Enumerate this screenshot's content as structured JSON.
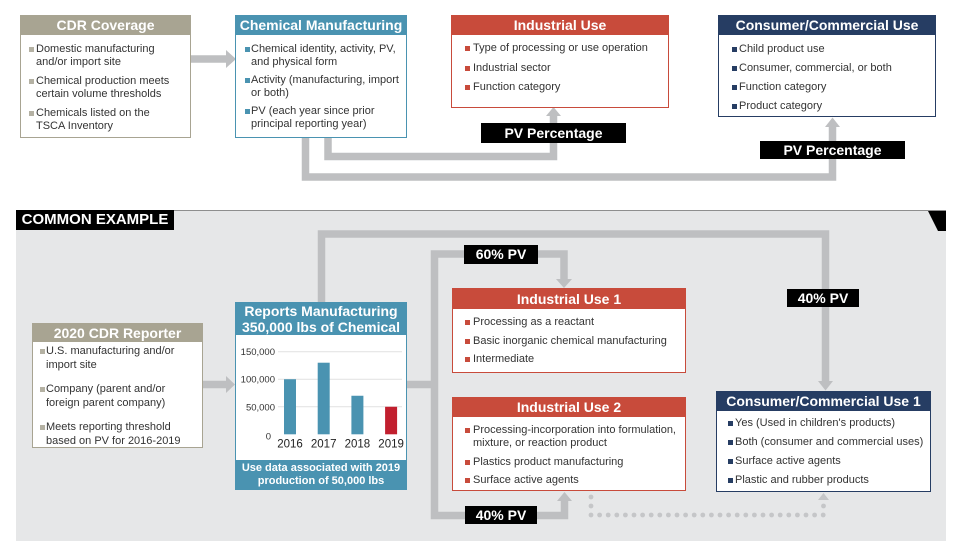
{
  "colors": {
    "cdr_olive": "#a8a492",
    "teal": "#4a93b1",
    "red": "#c84b3b",
    "navy": "#263d63",
    "connector": "#bebfc1",
    "panel": "#e6e7e8"
  },
  "top": {
    "cdr_coverage": {
      "title": "CDR Coverage",
      "items": [
        "Domestic manufacturing and/or import site",
        "Chemical production meets certain volume thresholds",
        "Chemicals listed on the TSCA Inventory"
      ]
    },
    "chemical_manufacturing": {
      "title": "Chemical Manufacturing",
      "items": [
        "Chemical identity, activity, PV, and physical form",
        "Activity (manufacturing, import or both)",
        "PV (each year since prior principal reporting year)"
      ]
    },
    "industrial_use": {
      "title": "Industrial Use",
      "items": [
        "Type of processing or use operation",
        "Industrial sector",
        "Function category"
      ]
    },
    "consumer_commercial_use": {
      "title": "Consumer/Commercial Use",
      "items": [
        "Child product use",
        "Consumer, commercial, or both",
        "Function category",
        "Product category"
      ]
    },
    "pv_label_industrial": "PV Percentage",
    "pv_label_consumer": "PV Percentage"
  },
  "example": {
    "section_label": "COMMON EXAMPLE",
    "cdr_reporter": {
      "title": "2020 CDR Reporter",
      "items": [
        "U.S. manufacturing and/or import site",
        "Company (parent and/or foreign parent company)",
        "Meets reporting threshold based on PV for 2016-2019"
      ]
    },
    "reports_manufacturing": {
      "title_lines": [
        "Reports Manufacturing",
        "350,000 lbs of Chemical"
      ],
      "footer_lines": [
        "Use data associated with 2019",
        "production of 50,000 lbs"
      ]
    },
    "industrial_use_1": {
      "title": "Industrial Use 1",
      "items": [
        "Processing as a reactant",
        "Basic inorganic chemical manufacturing",
        "Intermediate"
      ]
    },
    "industrial_use_2": {
      "title": "Industrial Use 2",
      "items": [
        "Processing-incorporation into formulation, mixture, or reaction product",
        "Plastics product manufacturing",
        "Surface active agents"
      ]
    },
    "consumer_commercial_use_1": {
      "title": "Consumer/Commercial Use 1",
      "items": [
        "Yes (Used in children's products)",
        "Both (consumer and commercial uses)",
        "Surface active agents",
        "Plastic and rubber products"
      ]
    },
    "flow_labels": {
      "to_industrial_use_1": "60% PV",
      "to_industrial_use_2": "40% PV",
      "to_consumer_use_1": "40% PV"
    }
  },
  "chart_data": {
    "type": "bar",
    "title": "Reports Manufacturing 350,000 lbs of Chemical",
    "xlabel": "",
    "ylabel": "",
    "categories": [
      "2016",
      "2017",
      "2018",
      "2019"
    ],
    "values": [
      100000,
      130000,
      70000,
      50000
    ],
    "bar_colors": [
      "#4a93b1",
      "#4a93b1",
      "#4a93b1",
      "#c11f2e"
    ],
    "highlighted_category": "2019",
    "ylim": [
      0,
      150000
    ],
    "yticks": [
      0,
      50000,
      100000,
      150000
    ],
    "ytick_labels": [
      "0",
      "50,000",
      "100,000",
      "150,000"
    ],
    "grid": true,
    "legend": "none"
  }
}
